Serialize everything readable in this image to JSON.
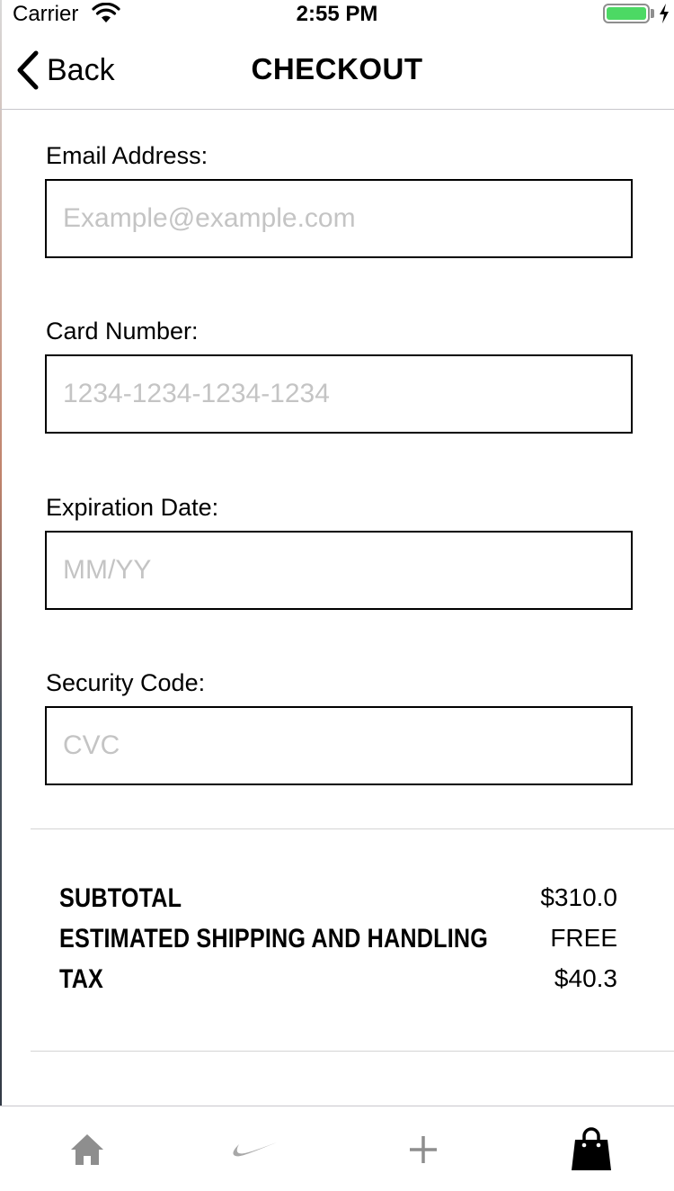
{
  "status_bar": {
    "carrier": "Carrier",
    "time": "2:55 PM",
    "battery_level": 1.0,
    "battery_color": "#4cd964"
  },
  "nav": {
    "back_label": "Back",
    "back_icon": "chevron-left-icon",
    "title": "CHECKOUT"
  },
  "form": {
    "email": {
      "label": "Email Address:",
      "value": "",
      "placeholder": "Example@example.com"
    },
    "card": {
      "label": "Card Number:",
      "value": "",
      "placeholder": "1234-1234-1234-1234"
    },
    "expiration": {
      "label": "Expiration Date:",
      "value": "",
      "placeholder": "MM/YY"
    },
    "security": {
      "label": "Security Code:",
      "value": "",
      "placeholder": "CVC"
    }
  },
  "summary": {
    "rows": [
      {
        "label": "SUBTOTAL",
        "value": "$310.0"
      },
      {
        "label": "ESTIMATED SHIPPING AND HANDLING",
        "value": "FREE"
      },
      {
        "label": "TAX",
        "value": "$40.3"
      }
    ]
  },
  "tab_bar": {
    "tabs": [
      {
        "name": "home",
        "icon": "home-icon",
        "active": false
      },
      {
        "name": "brand",
        "icon": "swoosh-logo-icon",
        "active": false
      },
      {
        "name": "add",
        "icon": "plus-icon",
        "active": false
      },
      {
        "name": "bag",
        "icon": "shopping-bag-icon",
        "active": true
      }
    ],
    "inactive_color": "#8e8e8e",
    "active_color": "#000000"
  }
}
